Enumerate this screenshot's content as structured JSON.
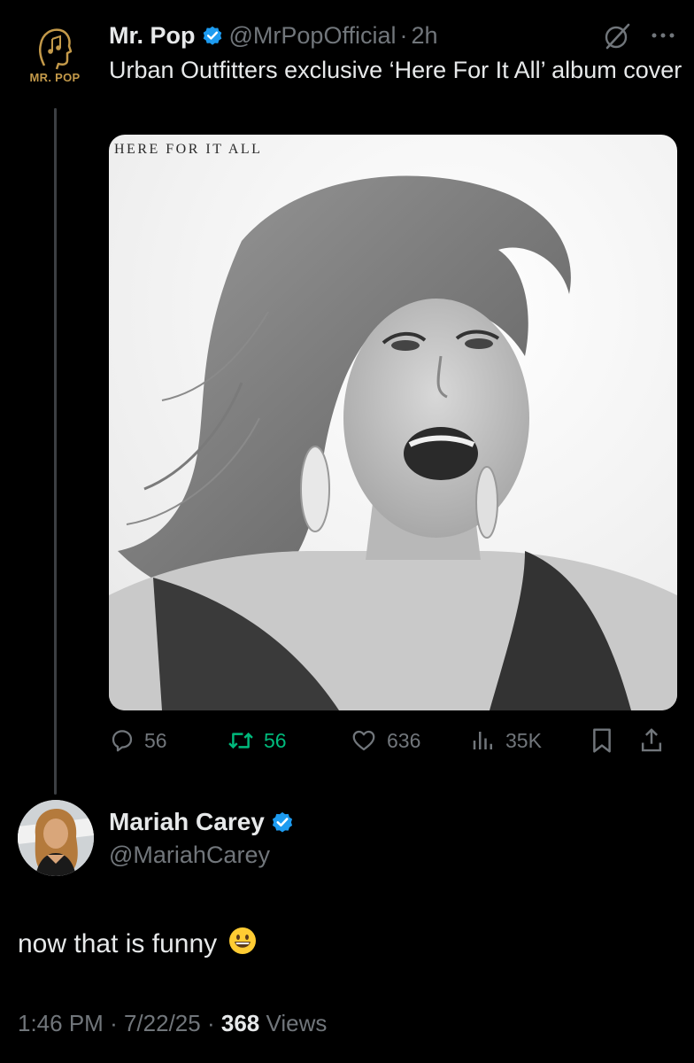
{
  "original_tweet": {
    "avatar_wordmark": "MR. POP",
    "author_name": "Mr. Pop",
    "handle": "@MrPopOfficial",
    "separator": "·",
    "time": "2h",
    "text": "Urban Outfitters exclusive ‘Here For It All’ album cover",
    "media": {
      "album_label": "HERE FOR IT ALL",
      "icon": "album-cover-photo"
    },
    "actions": {
      "replies": "56",
      "retweets": "56",
      "likes": "636",
      "views": "35K"
    },
    "colors": {
      "verified": "#1d9bf0",
      "retweet": "#00ba7c",
      "muted": "#71767b",
      "wordmark": "#c49a4a"
    }
  },
  "reply": {
    "author_name": "Mariah Carey",
    "handle": "@MariahCarey",
    "text": "now that is funny",
    "emoji": "grinning-face-emoji",
    "timestamp_time": "1:46 PM",
    "separator": "·",
    "timestamp_date": "7/22/25",
    "views_count": "368",
    "views_label": "Views"
  }
}
